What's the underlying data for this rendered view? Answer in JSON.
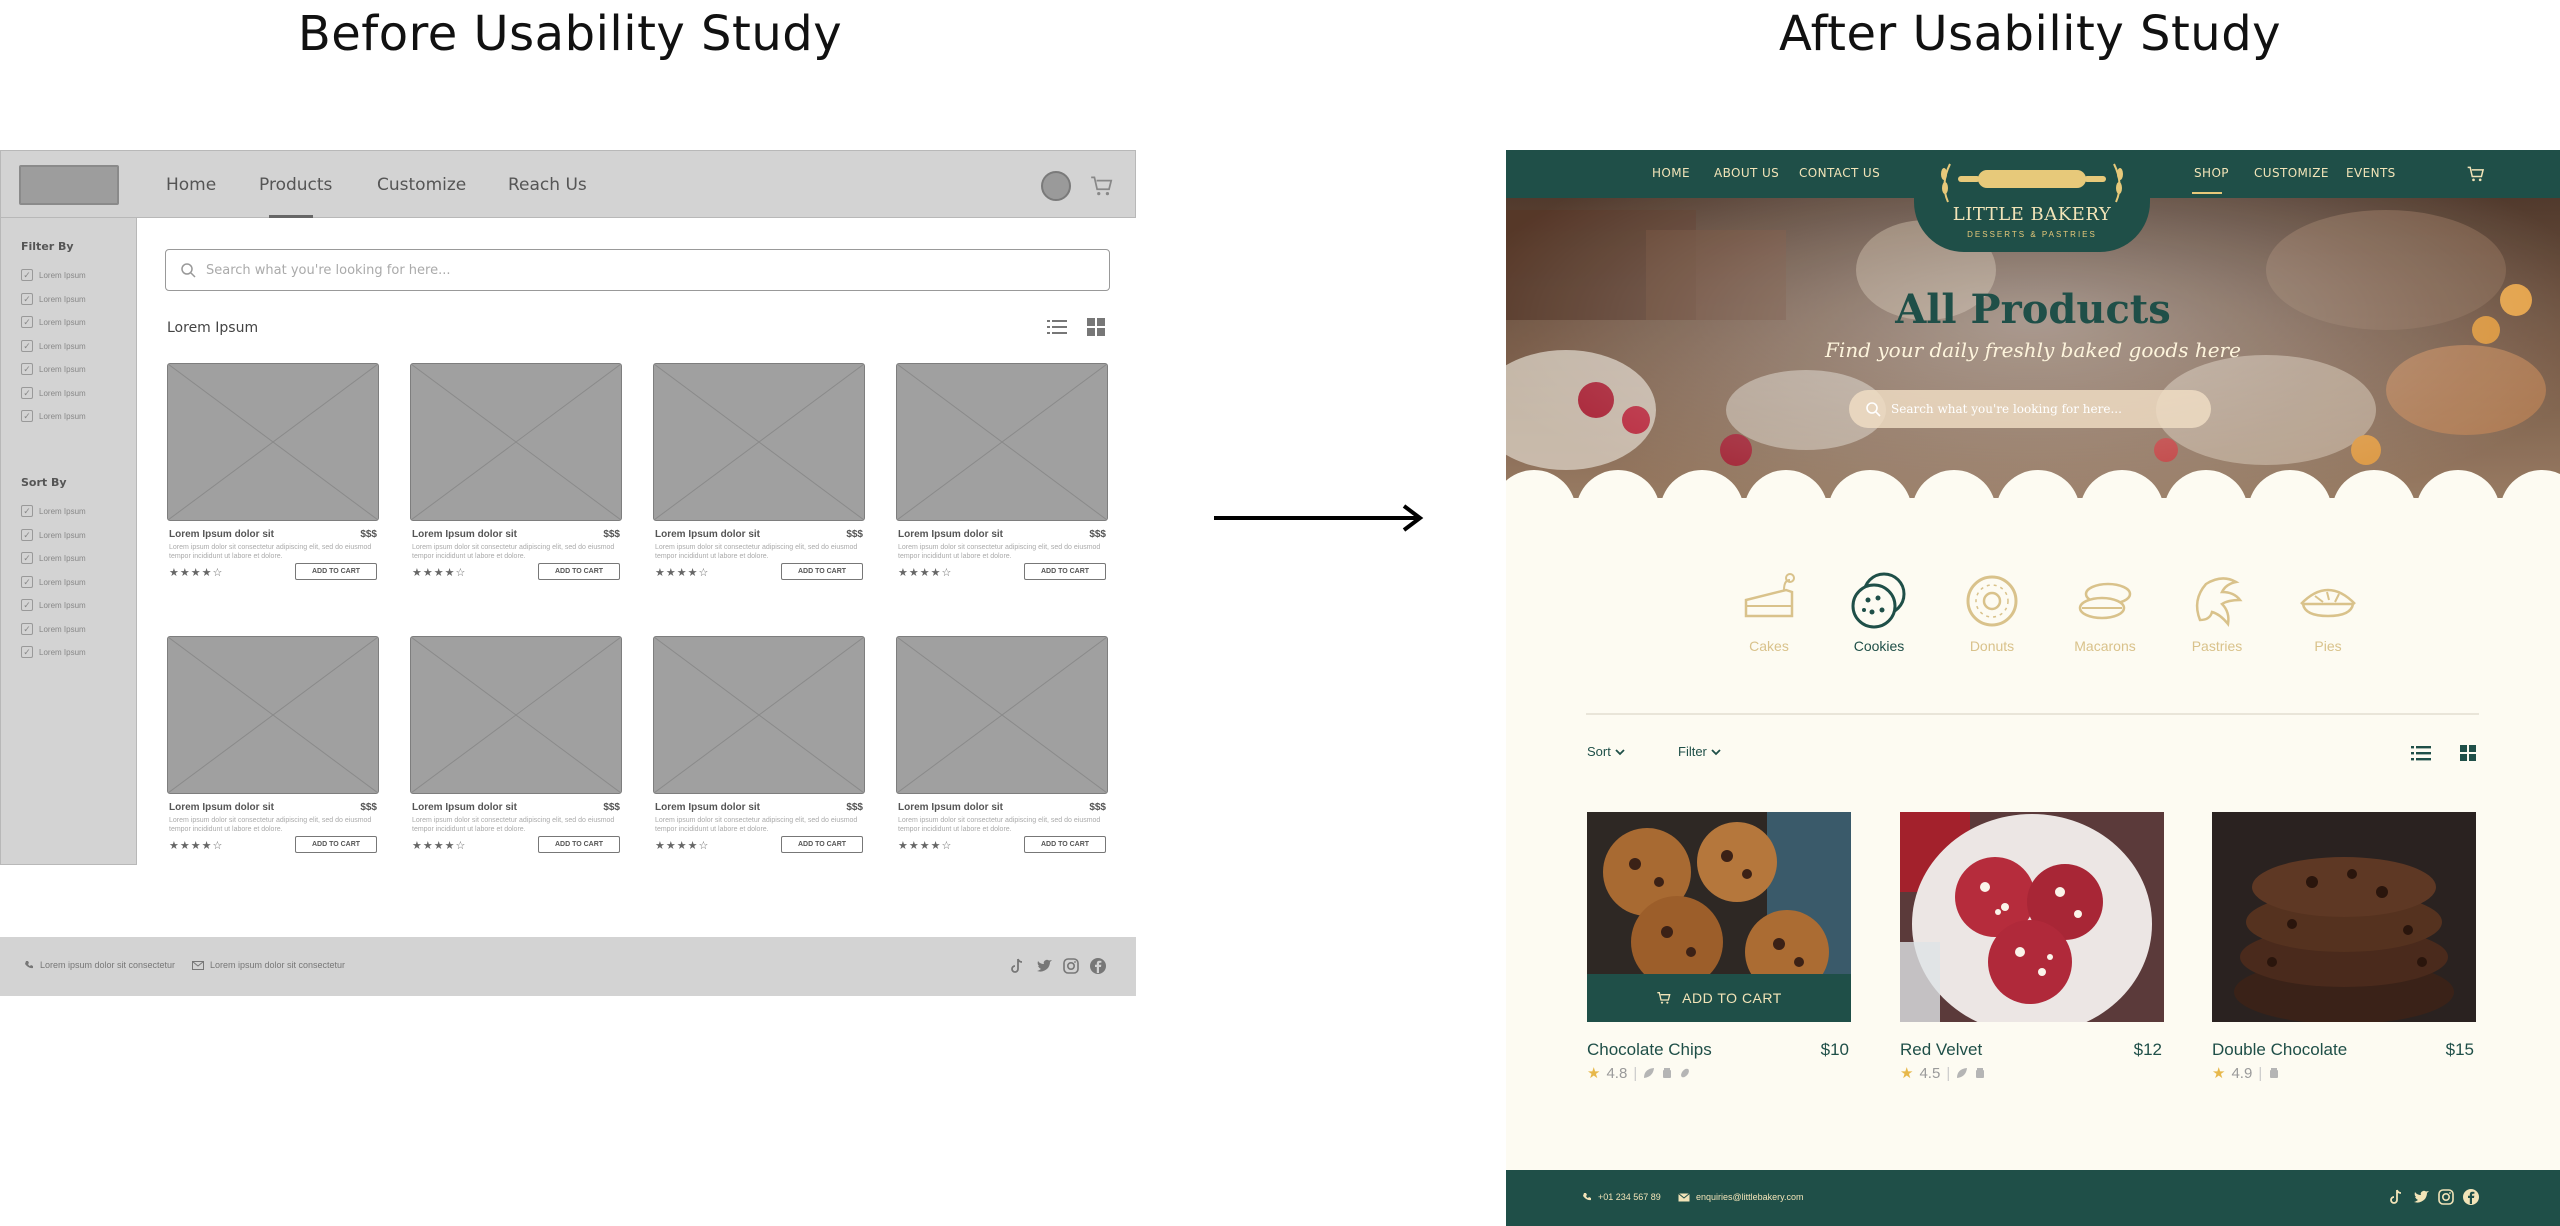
{
  "headings": {
    "before": "Before Usability Study",
    "after": "After Usability Study"
  },
  "wireframe": {
    "nav": [
      "Home",
      "Products",
      "Customize",
      "Reach Us"
    ],
    "filter_title": "Filter By",
    "sort_title": "Sort By",
    "option_label": "Lorem Ipsum",
    "search_placeholder": "Search what you're looking for here...",
    "section_label": "Lorem Ipsum",
    "product_name": "Lorem Ipsum dolor sit",
    "price": "$$$",
    "description": "Lorem ipsum dolor sit consectetur adipiscing elit, sed do eiusmod tempor incididunt ut labore et dolore.",
    "rating_stars": "★★★★☆",
    "add_to_cart": "ADD TO CART",
    "footer_phone": "Lorem ipsum dolor sit consectetur",
    "footer_email": "Lorem ipsum dolor sit consectetur",
    "colors": {
      "bar": "#d3d3d3",
      "placeholder": "#a0a0a0"
    }
  },
  "after": {
    "nav_left": [
      "HOME",
      "ABOUT US",
      "CONTACT US"
    ],
    "nav_right": [
      "SHOP",
      "CUSTOMIZE",
      "EVENTS"
    ],
    "brand": "LITTLE BAKERY",
    "tagline": "DESSERTS & PASTRIES",
    "hero_title": "All Products",
    "hero_subtitle": "Find your daily freshly baked goods here",
    "search_placeholder": "Search what you're looking for here...",
    "categories": [
      "Cakes",
      "Cookies",
      "Donuts",
      "Macarons",
      "Pastries",
      "Pies"
    ],
    "active_category": "Cookies",
    "sort_label": "Sort",
    "filter_label": "Filter",
    "add_to_cart": "ADD TO CART",
    "products": [
      {
        "name": "Chocolate Chips",
        "price": "$10",
        "rating": "4.8"
      },
      {
        "name": "Red Velvet",
        "price": "$12",
        "rating": "4.5"
      },
      {
        "name": "Double Chocolate",
        "price": "$15",
        "rating": "4.9"
      }
    ],
    "footer_phone": "+01 234 567 89",
    "footer_email": "enquiries@littlebakery.com",
    "colors": {
      "primary": "#1f4f48",
      "accent": "#e7c97a",
      "background": "#fdfbf2"
    }
  }
}
